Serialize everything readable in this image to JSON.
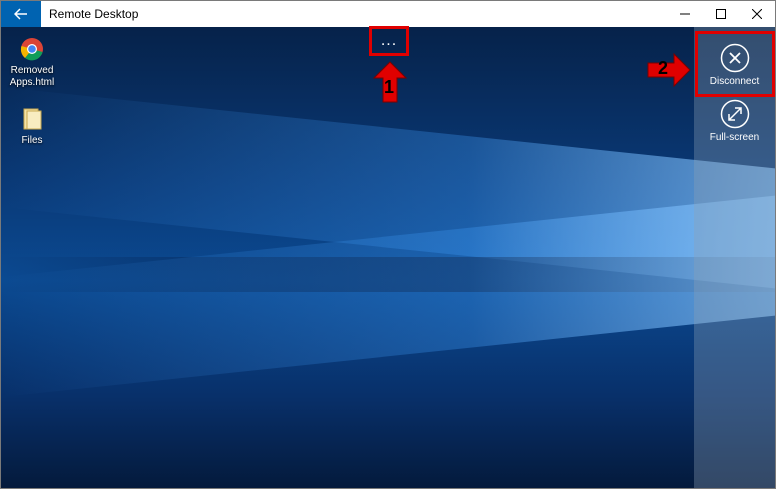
{
  "window": {
    "title": "Remote Desktop"
  },
  "desktop_icons": [
    {
      "label": "Removed\nApps.html",
      "icon": "chrome-icon"
    },
    {
      "label": "Files",
      "icon": "folder-icon"
    }
  ],
  "toolbar": {
    "more_label": "..."
  },
  "panel": {
    "disconnect_label": "Disconnect",
    "fullscreen_label": "Full-screen"
  },
  "annotations": {
    "step1": "1",
    "step2": "2"
  },
  "colors": {
    "accent": "#0063b1",
    "highlight": "#e00000"
  }
}
